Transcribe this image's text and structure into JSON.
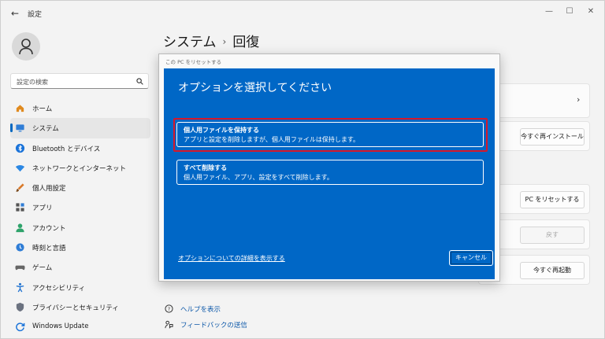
{
  "window": {
    "app_title": "設定",
    "back_glyph": "←",
    "min_glyph": "—",
    "max_glyph": "☐",
    "close_glyph": "✕"
  },
  "search": {
    "placeholder": "設定の検索"
  },
  "sidebar": {
    "items": [
      {
        "label": "ホーム",
        "icon": "home-icon"
      },
      {
        "label": "システム",
        "icon": "system-icon",
        "active": true
      },
      {
        "label": "Bluetooth とデバイス",
        "icon": "bluetooth-icon"
      },
      {
        "label": "ネットワークとインターネット",
        "icon": "network-icon"
      },
      {
        "label": "個人用設定",
        "icon": "personalization-icon"
      },
      {
        "label": "アプリ",
        "icon": "apps-icon"
      },
      {
        "label": "アカウント",
        "icon": "account-icon"
      },
      {
        "label": "時刻と言語",
        "icon": "time-language-icon"
      },
      {
        "label": "ゲーム",
        "icon": "gaming-icon"
      },
      {
        "label": "アクセシビリティ",
        "icon": "accessibility-icon"
      },
      {
        "label": "プライバシーとセキュリティ",
        "icon": "privacy-icon"
      },
      {
        "label": "Windows Update",
        "icon": "windows-update-icon"
      }
    ]
  },
  "breadcrumb": {
    "parent": "システム",
    "separator": "›",
    "current": "回復"
  },
  "cards": {
    "reinstall_button": "今すぐ再インストール",
    "reset_button": "PC をリセットする",
    "go_back_button": "戻す",
    "restart_button": "今すぐ再起動",
    "chevron": "›"
  },
  "links": {
    "help": "ヘルプを表示",
    "feedback": "フィードバックの送信"
  },
  "dialog": {
    "window_title": "この PC をリセットする",
    "heading": "オプションを選択してください",
    "options": [
      {
        "title": "個人用ファイルを保持する",
        "desc": "アプリと設定を削除しますが、個人用ファイルは保持します。"
      },
      {
        "title": "すべて削除する",
        "desc": "個人用ファイル、アプリ、設定をすべて削除します。"
      }
    ],
    "details_link": "オプションについての詳細を表示する",
    "cancel_button": "キャンセル"
  },
  "colors": {
    "dialog_blue": "#0067c6",
    "highlight_red": "#d6182a",
    "accent": "#0067c0"
  }
}
